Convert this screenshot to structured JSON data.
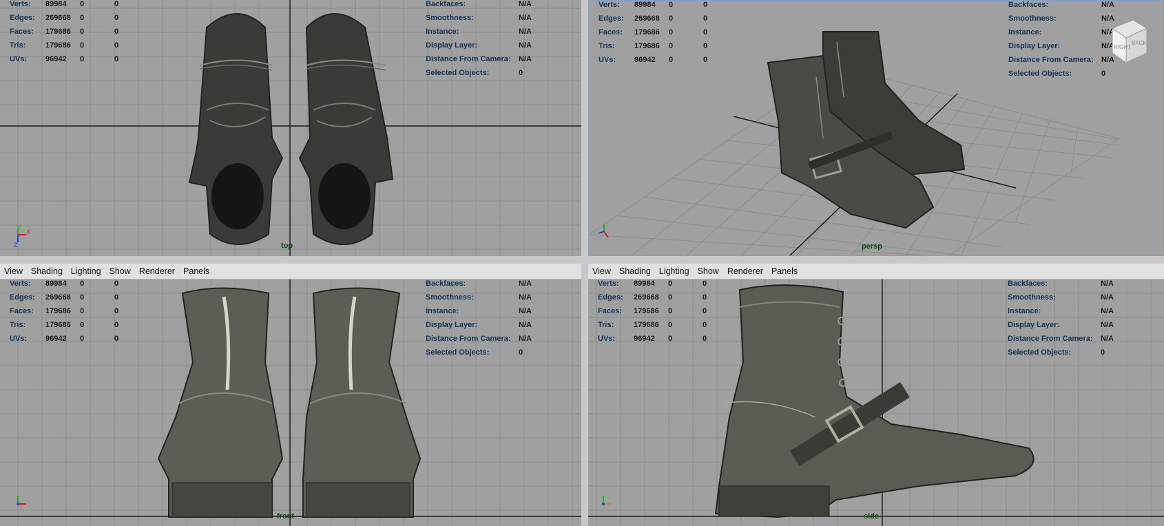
{
  "menu": [
    "View",
    "Shading",
    "Lighting",
    "Show",
    "Renderer",
    "Panels"
  ],
  "hud_left": [
    {
      "label": "Verts:",
      "value": "89984",
      "a": "0",
      "b": "0"
    },
    {
      "label": "Edges:",
      "value": "269668",
      "a": "0",
      "b": "0"
    },
    {
      "label": "Faces:",
      "value": "179686",
      "a": "0",
      "b": "0"
    },
    {
      "label": "Tris:",
      "value": "179686",
      "a": "0",
      "b": "0"
    },
    {
      "label": "UVs:",
      "value": "96942",
      "a": "0",
      "b": "0"
    }
  ],
  "hud_right": [
    {
      "label": "Backfaces:",
      "value": "N/A"
    },
    {
      "label": "Smoothness:",
      "value": "N/A"
    },
    {
      "label": "Instance:",
      "value": "N/A"
    },
    {
      "label": "Display Layer:",
      "value": "N/A"
    },
    {
      "label": "Distance From Camera:",
      "value": "N/A"
    },
    {
      "label": "Selected Objects:",
      "value": "0"
    }
  ],
  "viewports": {
    "top": {
      "camera": "top",
      "axis_a": "Y",
      "axis_b": "X",
      "axis_c": "Z"
    },
    "persp": {
      "camera": "persp",
      "cube_right": "RIGHT",
      "cube_back": "BACK"
    },
    "front": {
      "camera": "front"
    },
    "side": {
      "camera": "side"
    }
  },
  "colors": {
    "viewport_bg": "#a0a0a0",
    "grid": "#8a8a8a",
    "grid_axis": "#1c1c1c",
    "hud_label": "#143354"
  }
}
